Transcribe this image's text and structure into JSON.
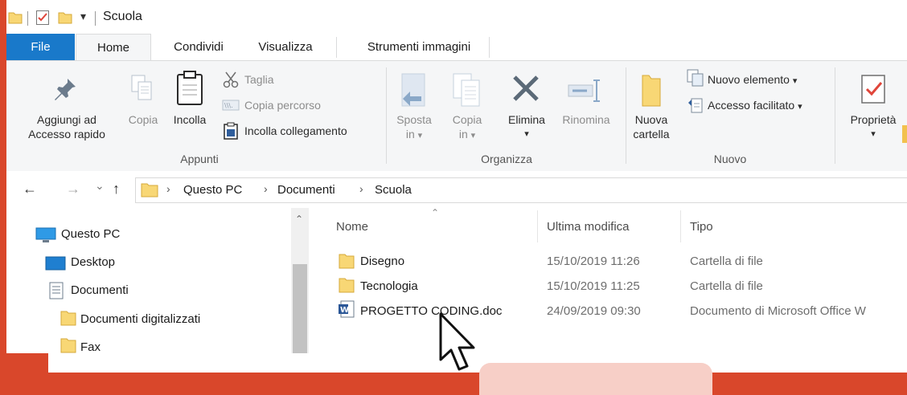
{
  "titlebar": {
    "title": "Scuola",
    "qat_dropdown": "▾"
  },
  "tabs": [
    {
      "label": "File"
    },
    {
      "label": "Home"
    },
    {
      "label": "Condividi"
    },
    {
      "label": "Visualizza"
    },
    {
      "label": "Strumenti immagini"
    }
  ],
  "ribbon": {
    "appunti": {
      "pin_line1": "Aggiungi ad",
      "pin_line2": "Accesso rapido",
      "copy": "Copia",
      "paste": "Incolla",
      "cut": "Taglia",
      "copy_path": "Copia percorso",
      "paste_link": "Incolla collegamento",
      "group": "Appunti"
    },
    "organizza": {
      "move_line1": "Sposta",
      "move_line2": "in",
      "copyto_line1": "Copia",
      "copyto_line2": "in",
      "delete": "Elimina",
      "rename": "Rinomina",
      "group": "Organizza"
    },
    "nuovo": {
      "folder_line1": "Nuova",
      "folder_line2": "cartella",
      "new_item": "Nuovo elemento",
      "easy_access": "Accesso facilitato",
      "group": "Nuovo"
    },
    "apri": {
      "properties": "Proprietà"
    },
    "dropdown_glyph": "▾"
  },
  "address": {
    "back": "←",
    "forward": "→",
    "recent": "⌄",
    "up": "↑",
    "crumbs": [
      "Questo PC",
      "Documenti",
      "Scuola"
    ],
    "crumb_sep": "›"
  },
  "navpane": {
    "items": [
      {
        "label": "Questo PC"
      },
      {
        "label": "Desktop"
      },
      {
        "label": "Documenti"
      },
      {
        "label": "Documenti digitalizzati"
      },
      {
        "label": "Fax"
      }
    ],
    "scroll_up": "⌃"
  },
  "filelist": {
    "sort_indicator": "⌃",
    "columns": [
      "Nome",
      "Ultima modifica",
      "Tipo"
    ],
    "rows": [
      {
        "name": "Disegno",
        "modified": "15/10/2019 11:26",
        "type": "Cartella di file",
        "icon": "folder-icon"
      },
      {
        "name": "Tecnologia",
        "modified": "15/10/2019 11:25",
        "type": "Cartella di file",
        "icon": "folder-icon"
      },
      {
        "name": "PROGETTO CODING.doc",
        "modified": "24/09/2019 09:30",
        "type": "Documento di Microsoft Office W",
        "icon": "word-document-icon"
      }
    ]
  },
  "colors": {
    "accent": "#1979ca",
    "background_red": "#d9472b",
    "ribbon": "#f5f6f7",
    "folder": "#f8d775"
  }
}
